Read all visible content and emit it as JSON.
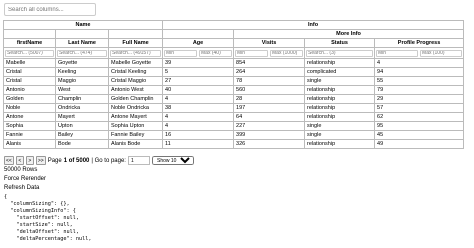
{
  "search_all": {
    "placeholder": "Search all columns..."
  },
  "headers": {
    "group_name": "Name",
    "group_info": "Info",
    "group_more_info": "More Info",
    "columns": [
      "firstName",
      "Last Name",
      "Full Name",
      "Age",
      "Visits",
      "Status",
      "Profile Progress"
    ]
  },
  "filters": {
    "firstName": "Search... (5007)",
    "lastName": "Search... (474)",
    "fullName": "Search... (49157)",
    "age_min": "Min",
    "age_max": "Max (40)",
    "visits_min": "Min",
    "visits_max": "Max (1000)",
    "status": "Search... (3)",
    "progress_min": "Min",
    "progress_max": "Max (100)"
  },
  "rows": [
    [
      "Mabelle",
      "Goyette",
      "Mabelle Goyette",
      "39",
      "854",
      "relationship",
      "4"
    ],
    [
      "Cristal",
      "Keeling",
      "Cristal Keeling",
      "5",
      "264",
      "complicated",
      "94"
    ],
    [
      "Cristal",
      "Maggio",
      "Cristal Maggio",
      "27",
      "78",
      "single",
      "55"
    ],
    [
      "Antonio",
      "West",
      "Antonio West",
      "40",
      "560",
      "relationship",
      "79"
    ],
    [
      "Golden",
      "Champlin",
      "Golden Champlin",
      "4",
      "28",
      "relationship",
      "29"
    ],
    [
      "Noble",
      "Ondricka",
      "Noble Ondricka",
      "38",
      "197",
      "relationship",
      "57"
    ],
    [
      "Antone",
      "Mayert",
      "Antone Mayert",
      "4",
      "64",
      "relationship",
      "62"
    ],
    [
      "Sophia",
      "Upton",
      "Sophia Upton",
      "4",
      "227",
      "single",
      "95"
    ],
    [
      "Fannie",
      "Bailey",
      "Fannie Bailey",
      "16",
      "399",
      "single",
      "45"
    ],
    [
      "Alanis",
      "Bode",
      "Alanis Bode",
      "11",
      "326",
      "relationship",
      "49"
    ]
  ],
  "pager": {
    "first": "<<",
    "prev": "<",
    "next": ">",
    "last": ">>",
    "page_word": "Page",
    "page_of": "1 of 5000",
    "goto_label": "| Go to page:",
    "goto_value": "1",
    "show_option": "Show 10"
  },
  "info": {
    "rows_count": "50000 Rows",
    "force_rerender": "Force Rerender",
    "refresh_data": "Refresh Data"
  },
  "state_json": [
    "{",
    "  \"columnSizing\": {},",
    "  \"columnSizingInfo\": {",
    "    \"startOffset\": null,",
    "    \"startSize\": null,",
    "    \"deltaOffset\": null,",
    "    \"deltaPercentage\": null,"
  ]
}
